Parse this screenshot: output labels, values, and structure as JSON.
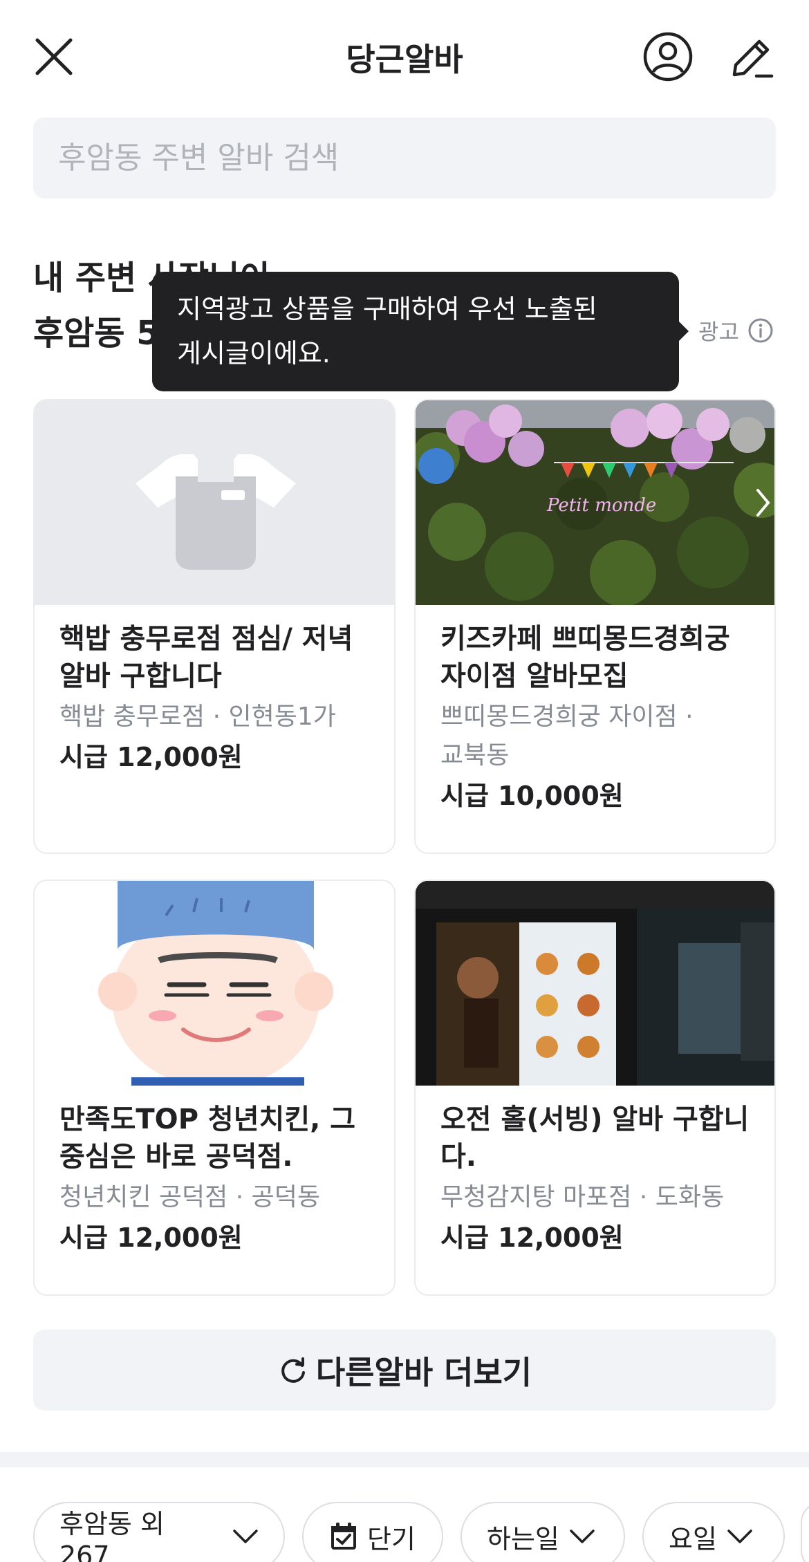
{
  "header": {
    "title": "당근알바"
  },
  "search": {
    "placeholder": "후암동 주변 알바 검색"
  },
  "section": {
    "heading_line1": "내 주변 사장님이",
    "heading_line2": "후암동 5",
    "ad_label": "광고"
  },
  "tooltip": {
    "line1": "지역광고 상품을 구매하여 우선 노출된",
    "line2": "게시글이에요."
  },
  "cards": [
    {
      "title_line1": "핵밥 충무로점 점심/ 저녁",
      "title_line2": "알바 구합니다",
      "meta_line1": "핵밥 충무로점 · 인현동1가",
      "meta_line2": "",
      "pay": "시급 12,000원"
    },
    {
      "title_line1": "키즈카페 쁘띠몽드경희궁",
      "title_line2": "자이점 알바모집",
      "meta_line1": "쁘띠몽드경희궁 자이점 ·",
      "meta_line2": "교북동",
      "pay": "시급 10,000원",
      "image_sign": "Petit monde"
    },
    {
      "title_line1": "만족도TOP 청년치킨, 그",
      "title_line2": "중심은 바로 공덕점.",
      "meta_line1": "청년치킨 공덕점 · 공덕동",
      "meta_line2": "",
      "pay": "시급 12,000원"
    },
    {
      "title_line1": "오전 홀(서빙) 알바 구합니",
      "title_line2": "다.",
      "meta_line1": "무청감지탕 마포점 · 도화동",
      "meta_line2": "",
      "pay": "시급 12,000원"
    }
  ],
  "more_button": {
    "label": "다른알바 더보기"
  },
  "filters": [
    {
      "label": "후암동 외 267"
    },
    {
      "label": "단기"
    },
    {
      "label": "하는일"
    },
    {
      "label": "요일"
    }
  ],
  "colors": {
    "text_primary": "#212124",
    "text_secondary": "#868b94",
    "surface": "#f2f3f6",
    "tooltip_bg": "#212124",
    "card_border": "#eaebee"
  }
}
